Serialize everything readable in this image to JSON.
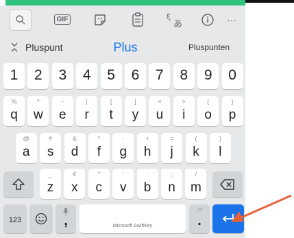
{
  "toolbar": {
    "gif_label": "GIF",
    "translate_label": "あ",
    "more_label": "···"
  },
  "suggestions": [
    "Pluspunt",
    "Plus",
    "Pluspunten"
  ],
  "rows": {
    "numbers": [
      "1",
      "2",
      "3",
      "4",
      "5",
      "6",
      "7",
      "8",
      "9",
      "0"
    ],
    "row1": [
      {
        "k": "q",
        "s": "%"
      },
      {
        "k": "w",
        "s": "^"
      },
      {
        "k": "e",
        "s": "~"
      },
      {
        "k": "r",
        "s": "|"
      },
      {
        "k": "t",
        "s": "["
      },
      {
        "k": "y",
        "s": "]"
      },
      {
        "k": "u",
        "s": "<"
      },
      {
        "k": "i",
        "s": ">"
      },
      {
        "k": "o",
        "s": "{"
      },
      {
        "k": "p",
        "s": "}"
      }
    ],
    "row2": [
      {
        "k": "a",
        "s": "@"
      },
      {
        "k": "s",
        "s": "#"
      },
      {
        "k": "d",
        "s": "&"
      },
      {
        "k": "f",
        "s": "*"
      },
      {
        "k": "g",
        "s": "-"
      },
      {
        "k": "h",
        "s": "+"
      },
      {
        "k": "j",
        "s": "="
      },
      {
        "k": "k",
        "s": "("
      },
      {
        "k": "l",
        "s": ")"
      }
    ],
    "row3": [
      {
        "k": "z",
        "s": "_"
      },
      {
        "k": "x",
        "s": "€"
      },
      {
        "k": "c",
        "s": "\""
      },
      {
        "k": "v",
        "s": "'"
      },
      {
        "k": "b",
        "s": ":"
      },
      {
        "k": "n",
        "s": ";"
      },
      {
        "k": "m",
        "s": "/"
      }
    ]
  },
  "bottom": {
    "symbols_label": "123",
    "comma_label": ",",
    "space_label": "Microsoft SwiftKey",
    "period_label": ".",
    "period_sub": ",!?"
  },
  "colors": {
    "accent": "#1a73e8",
    "enter_key": "#1a73e8",
    "arrow": "#e8623a",
    "top_bar": "#2ec27e"
  }
}
